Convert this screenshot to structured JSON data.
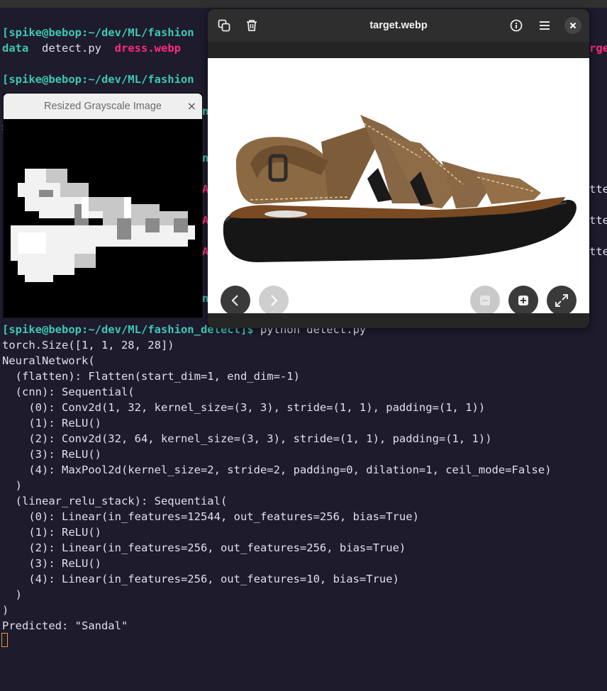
{
  "terminal": {
    "prompt": "[spike@bebop:~/dev/ML/fashion_detect]$",
    "prompt_cut": "[spike@bebop:~/dev/ML/fashion",
    "ls": {
      "dir": "data",
      "file1": "detect.py",
      "file2": "dress.webp",
      "file_cut": "rge"
    },
    "hidden_frags": {
      "s": "s",
      "n": "n",
      "A": "A",
      "tte": "tte"
    },
    "command": "python detect.py",
    "output": [
      "torch.Size([1, 1, 28, 28])",
      "NeuralNetwork(",
      "  (flatten): Flatten(start_dim=1, end_dim=-1)",
      "  (cnn): Sequential(",
      "    (0): Conv2d(1, 32, kernel_size=(3, 3), stride=(1, 1), padding=(1, 1))",
      "    (1): ReLU()",
      "    (2): Conv2d(32, 64, kernel_size=(3, 3), stride=(1, 1), padding=(1, 1))",
      "    (3): ReLU()",
      "    (4): MaxPool2d(kernel_size=2, stride=2, padding=0, dilation=1, ceil_mode=False)",
      "  )",
      "  (linear_relu_stack): Sequential(",
      "    (0): Linear(in_features=12544, out_features=256, bias=True)",
      "    (1): ReLU()",
      "    (2): Linear(in_features=256, out_features=256, bias=True)",
      "    (3): ReLU()",
      "    (4): Linear(in_features=256, out_features=10, bias=True)",
      "  )",
      ")",
      "Predicted: \"Sandal\""
    ]
  },
  "grayscale_window": {
    "title": "Resized Grayscale Image",
    "close": "×"
  },
  "viewer": {
    "title": "target.webp",
    "icons": [
      "copy-icon",
      "trash-icon",
      "info-icon",
      "menu-icon",
      "close-icon",
      "chevron-left-icon",
      "chevron-right-icon",
      "zoom-out-icon",
      "zoom-in-icon",
      "fullscreen-icon"
    ]
  },
  "colors": {
    "background": "#1d1b2c",
    "prompt": "#3fc7b4",
    "highlight": "#ff2b7a",
    "cursor": "#e89a2c"
  }
}
